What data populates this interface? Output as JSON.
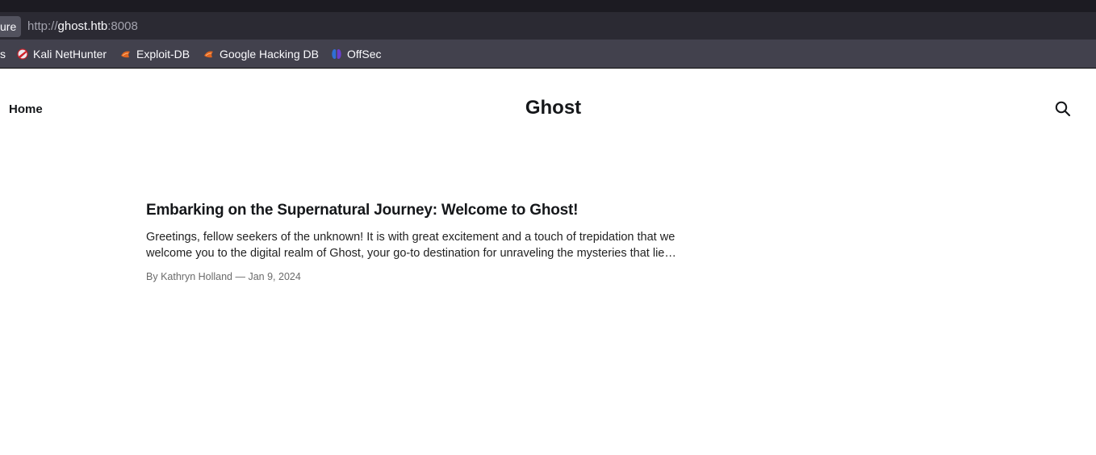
{
  "browser": {
    "security_label": "ure",
    "url_scheme": "http://",
    "url_host": "ghost.htb",
    "url_port": ":8008",
    "bookmarks": [
      {
        "label": "s",
        "icon": "none"
      },
      {
        "label": "Kali NetHunter",
        "icon": "nethunter-icon"
      },
      {
        "label": "Exploit-DB",
        "icon": "exploitdb-icon"
      },
      {
        "label": "Google Hacking DB",
        "icon": "ghdb-icon"
      },
      {
        "label": "OffSec",
        "icon": "offsec-icon"
      }
    ]
  },
  "site": {
    "nav_home": "Home",
    "title": "Ghost",
    "search_icon": "search-icon"
  },
  "post": {
    "title": "Embarking on the Supernatural Journey: Welcome to Ghost!",
    "excerpt": "Greetings, fellow seekers of the unknown! It is with great excitement and a touch of trepidation that we welcome you to the digital realm of Ghost, your go-to destination for unraveling the mysteries that lie…",
    "author_prefix": "By ",
    "author": "Kathryn Holland",
    "date_sep": " — ",
    "date": "Jan 9, 2024"
  }
}
